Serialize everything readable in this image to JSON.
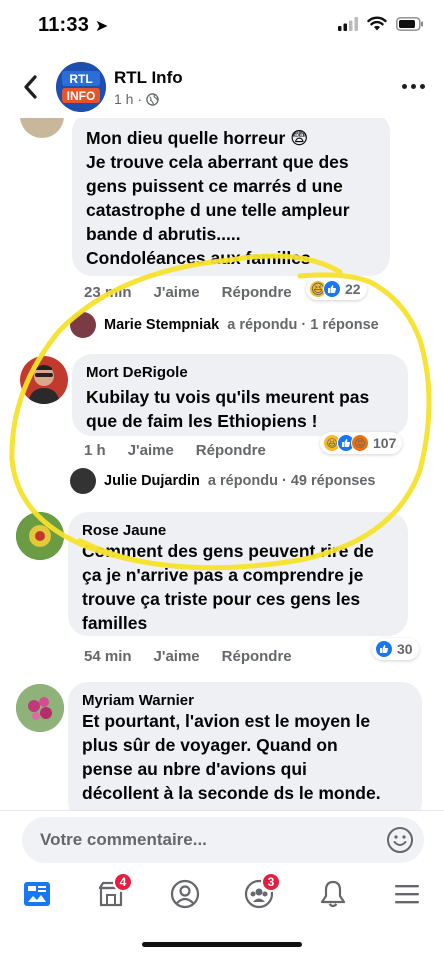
{
  "status_bar": {
    "time": "11:33"
  },
  "header": {
    "page_name": "RTL Info",
    "post_time": "1 h",
    "logo_text_top": "RTL",
    "logo_text_bottom": "INFO"
  },
  "comments": [
    {
      "text_lines": [
        "Mon dieu quelle horreur 😨",
        "Je trouve cela aberrant que des",
        "gens puissent ce marrés d une",
        "catastrophe d une telle ampleur",
        "bande d abrutis.....",
        "Condoléances aux familles"
      ],
      "time": "23 min",
      "like_label": "J'aime",
      "reply_label": "Répondre",
      "reaction_count": "22",
      "reply_summary": {
        "name": "Marie Stempniak",
        "text": "a répondu · 1 réponse"
      }
    },
    {
      "author": "Mort DeRigole",
      "tagged": "Kubilay",
      "text": "tu vois qu'ils meurent pas que de faim les Ethiopiens !",
      "time": "1 h",
      "like_label": "J'aime",
      "reply_label": "Répondre",
      "reaction_count": "107",
      "reply_summary": {
        "name": "Julie Dujardin",
        "text": "a répondu · 49 réponses"
      }
    },
    {
      "author": "Rose Jaune",
      "text_lines": [
        "Comment des gens peuvent rire de",
        "ça je n'arrive pas a comprendre je",
        "trouve ça triste pour ces gens les",
        "familles"
      ],
      "time": "54 min",
      "like_label": "J'aime",
      "reply_label": "Répondre",
      "reaction_count": "30"
    },
    {
      "author": "Myriam Warnier",
      "text_lines": [
        "Et pourtant, l'avion est le moyen le",
        "plus sûr de voyager. Quand on",
        "pense au nbre d'avions qui",
        "décollent à la seconde ds le monde."
      ]
    }
  ],
  "composer": {
    "placeholder": "Votre commentaire..."
  },
  "bottom_nav": {
    "items": [
      {
        "icon": "news-feed-icon",
        "active": true
      },
      {
        "icon": "marketplace-icon",
        "badge": "4"
      },
      {
        "icon": "profile-icon"
      },
      {
        "icon": "groups-icon",
        "badge": "3"
      },
      {
        "icon": "notifications-bell-icon"
      },
      {
        "icon": "menu-icon"
      }
    ]
  },
  "colors": {
    "facebook_blue": "#1877f2",
    "badge_red": "#e41e3f",
    "highlight_yellow": "#f6e22a",
    "bubble_gray": "#eef0f3"
  }
}
